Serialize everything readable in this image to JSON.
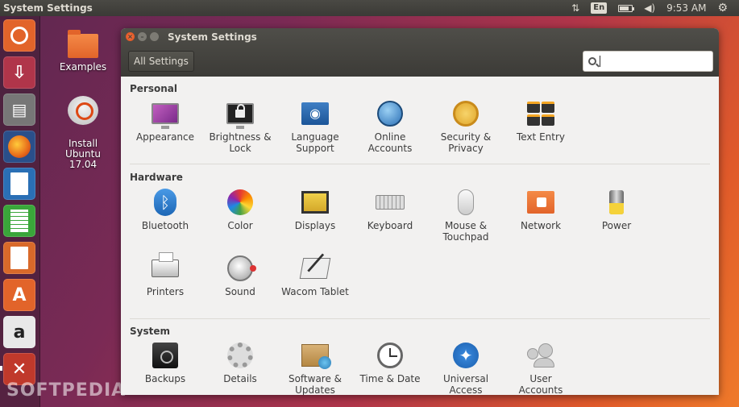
{
  "top_panel": {
    "app_title": "System Settings",
    "lang": "En",
    "time": "9:53 AM"
  },
  "launcher": {
    "items": [
      {
        "name": "dash-home",
        "color": "#e2642a",
        "glyph": "◎"
      },
      {
        "name": "install-ubuntu",
        "color": "#b0354a",
        "glyph": "⇩"
      },
      {
        "name": "files",
        "color": "#6a6a6a",
        "glyph": "▤"
      },
      {
        "name": "firefox",
        "color": "#e66a1a",
        "glyph": "●"
      },
      {
        "name": "libreoffice-writer",
        "color": "#2a6fb5",
        "glyph": "≡"
      },
      {
        "name": "libreoffice-calc",
        "color": "#3aa63a",
        "glyph": "▦"
      },
      {
        "name": "libreoffice-impress",
        "color": "#d9692a",
        "glyph": "▭"
      },
      {
        "name": "ubuntu-software",
        "color": "#e2642a",
        "glyph": "A"
      },
      {
        "name": "amazon",
        "color": "#e8e8e8",
        "glyph": "a"
      },
      {
        "name": "system-settings",
        "color": "#c0392b",
        "glyph": "✕"
      }
    ]
  },
  "desktop": {
    "examples": "Examples",
    "install": "Install\nUbuntu\n17.04"
  },
  "watermark": "SOFTPEDIA",
  "window": {
    "title": "System Settings",
    "all_settings": "All Settings",
    "search_value": "",
    "sections": {
      "personal": "Personal",
      "hardware": "Hardware",
      "system": "System"
    },
    "personal": [
      {
        "label": "Appearance"
      },
      {
        "label": "Brightness &\nLock"
      },
      {
        "label": "Language\nSupport"
      },
      {
        "label": "Online\nAccounts"
      },
      {
        "label": "Security &\nPrivacy"
      },
      {
        "label": "Text Entry"
      }
    ],
    "hardware": [
      {
        "label": "Bluetooth"
      },
      {
        "label": "Color"
      },
      {
        "label": "Displays"
      },
      {
        "label": "Keyboard"
      },
      {
        "label": "Mouse &\nTouchpad"
      },
      {
        "label": "Network"
      },
      {
        "label": "Power"
      },
      {
        "label": "Printers"
      },
      {
        "label": "Sound"
      },
      {
        "label": "Wacom Tablet"
      }
    ],
    "system": [
      {
        "label": "Backups"
      },
      {
        "label": "Details"
      },
      {
        "label": "Software &\nUpdates"
      },
      {
        "label": "Time & Date"
      },
      {
        "label": "Universal\nAccess"
      },
      {
        "label": "User\nAccounts"
      }
    ]
  }
}
